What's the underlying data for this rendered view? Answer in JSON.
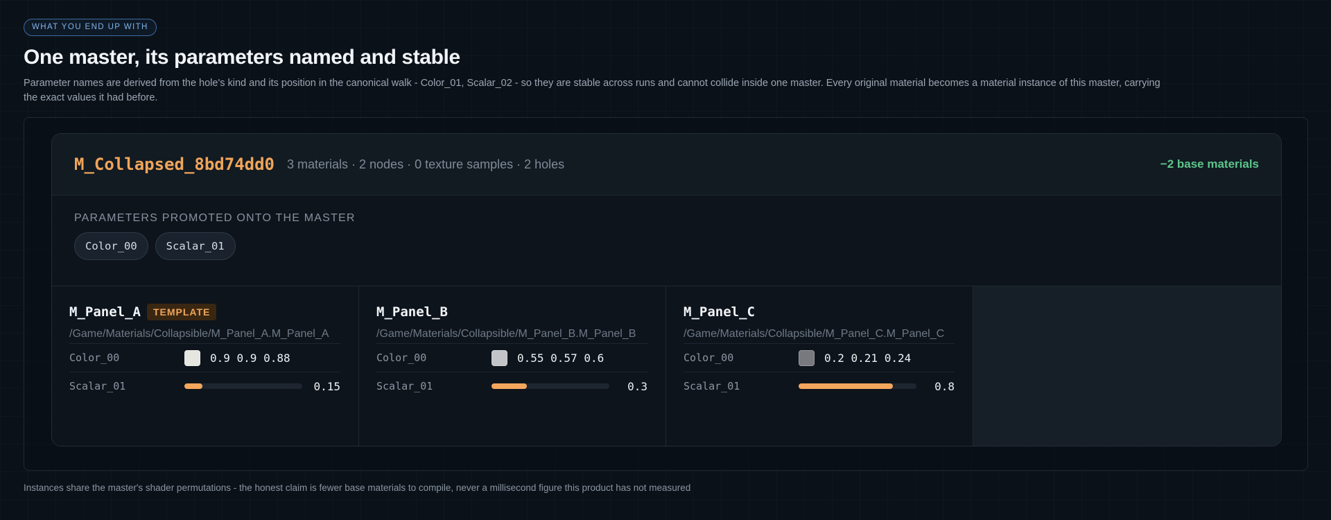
{
  "header": {
    "eyebrow": "WHAT YOU END UP WITH",
    "title": "One master, its parameters named and stable",
    "lede": "Parameter names are derived from the hole's kind and its position in the canonical walk - Color_01, Scalar_02 - so they are stable across runs and cannot collide inside one master. Every original material becomes a material instance of this master, carrying the exact values it had before."
  },
  "master": {
    "name": "M_Collapsed_8bd74dd0",
    "meta": "3 materials · 2 nodes · 0 texture samples · 2 holes",
    "delta": "−2 base materials",
    "delta_color": "#5cc58a"
  },
  "params": {
    "label": "PARAMETERS PROMOTED ONTO THE MASTER",
    "chips": [
      "Color_00",
      "Scalar_01"
    ]
  },
  "panels": [
    {
      "name": "M_Panel_A",
      "badge": "TEMPLATE",
      "path": "/Game/Materials/Collapsible/M_Panel_A.M_Panel_A",
      "color_param": "Color_00",
      "color_value": "0.9 0.9 0.88",
      "swatch": "#e6e6e0",
      "scalar_param": "Scalar_01",
      "scalar_value": "0.15",
      "scalar_fraction": 0.15
    },
    {
      "name": "M_Panel_B",
      "badge": "",
      "path": "/Game/Materials/Collapsible/M_Panel_B.M_Panel_B",
      "color_param": "Color_00",
      "color_value": "0.55 0.57 0.6",
      "swatch": "#c2c4c8",
      "scalar_param": "Scalar_01",
      "scalar_value": "0.3",
      "scalar_fraction": 0.3
    },
    {
      "name": "M_Panel_C",
      "badge": "",
      "path": "/Game/Materials/Collapsible/M_Panel_C.M_Panel_C",
      "color_param": "Color_00",
      "color_value": "0.2 0.21 0.24",
      "swatch": "#77797e",
      "scalar_param": "Scalar_01",
      "scalar_value": "0.8",
      "scalar_fraction": 0.8
    }
  ],
  "footnote": "Instances share the master's shader permutations - the honest claim is fewer base materials to compile, never a millisecond figure this product has not measured",
  "colors": {
    "accent_orange": "#f0a55a",
    "slider_fill": "#f4a65c",
    "eyebrow_blue": "#7fb3ea"
  }
}
